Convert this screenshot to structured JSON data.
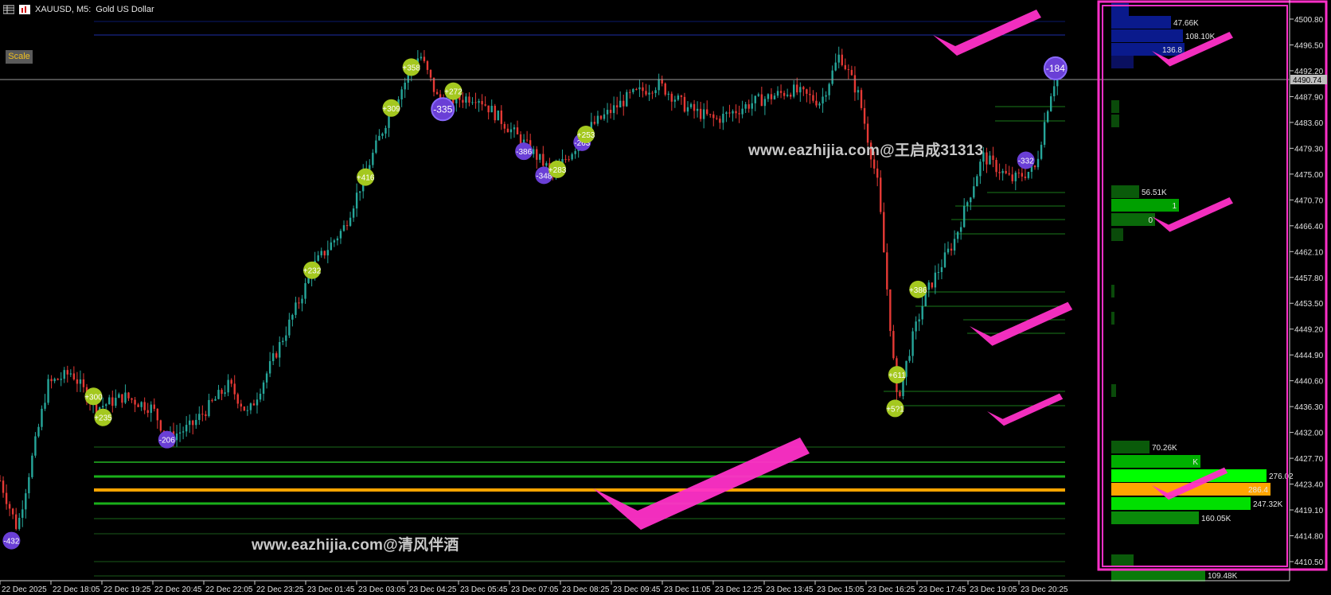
{
  "header": {
    "symbol_label": "XAUUSD, M5:",
    "description": "Gold US Dollar"
  },
  "toolbar": {
    "scale_label": "Scale"
  },
  "watermarks": [
    "www.eazhijia.com@王启成31313",
    "www.eazhijia.com@清风伴酒"
  ],
  "colors": {
    "bull": "#26a69a",
    "bear": "#e53935",
    "buy_badge": "#a4c81f",
    "sell_badge": "#6a3fd6",
    "poc": "#ffa500",
    "vol_dark": "#0a5a0a",
    "vol_mid": "#00a000",
    "vol_bright": "#00ff00",
    "vol_blue": "#0a1a8c",
    "annotation": "#ff30c8"
  },
  "price_axis": {
    "labels": [
      "4500.80",
      "4496.50",
      "4492.20",
      "4487.90",
      "4483.60",
      "4479.30",
      "4475.00",
      "4470.70",
      "4466.40",
      "4462.10",
      "4457.80",
      "4453.50",
      "4449.20",
      "4444.90",
      "4440.60",
      "4436.30",
      "4432.00",
      "4427.70",
      "4423.40",
      "4419.10",
      "4414.80",
      "4410.50"
    ],
    "current_price": "4490.74",
    "max": 4503.0,
    "min": 4408.0
  },
  "time_axis": {
    "labels": [
      "22 Dec 2025",
      "22 Dec 18:05",
      "22 Dec 19:25",
      "22 Dec 20:45",
      "22 Dec 22:05",
      "22 Dec 23:25",
      "23 Dec 01:45",
      "23 Dec 03:05",
      "23 Dec 04:25",
      "23 Dec 05:45",
      "23 Dec 07:05",
      "23 Dec 08:25",
      "23 Dec 09:45",
      "23 Dec 11:05",
      "23 Dec 12:25",
      "23 Dec 13:45",
      "23 Dec 15:05",
      "23 Dec 16:25",
      "23 Dec 17:45",
      "23 Dec 19:05",
      "23 Dec 20:25"
    ]
  },
  "volume_profile": {
    "labels": [
      "47.66K",
      "108.10K",
      "136.8",
      "56.51K",
      "1",
      "0",
      "70.26K",
      "K",
      "276.02",
      "286.4",
      "247.32K",
      "160.05K",
      "109.48K"
    ]
  },
  "badges": [
    {
      "label": "-432",
      "type": "sell",
      "price": 4414.0,
      "t": 0.012
    },
    {
      "label": "+300",
      "type": "buy",
      "price": 4438.0,
      "t": 0.098
    },
    {
      "label": "+235",
      "type": "buy",
      "price": 4434.5,
      "t": 0.108
    },
    {
      "label": "-206",
      "type": "sell",
      "price": 4430.8,
      "t": 0.175
    },
    {
      "label": "+232",
      "type": "buy",
      "price": 4459.0,
      "t": 0.327
    },
    {
      "label": "+416",
      "type": "buy",
      "price": 4474.5,
      "t": 0.383
    },
    {
      "label": "+309",
      "type": "buy",
      "price": 4486.0,
      "t": 0.41
    },
    {
      "label": "+358",
      "type": "buy",
      "price": 4492.8,
      "t": 0.431
    },
    {
      "label": "-335",
      "type": "sell",
      "price": 4485.8,
      "t": 0.464
    },
    {
      "label": "+272",
      "type": "buy",
      "price": 4488.8,
      "t": 0.475
    },
    {
      "label": "-386",
      "type": "sell",
      "price": 4478.8,
      "t": 0.549
    },
    {
      "label": "-348",
      "type": "sell",
      "price": 4474.8,
      "t": 0.57
    },
    {
      "label": "+283",
      "type": "buy",
      "price": 4475.8,
      "t": 0.584
    },
    {
      "label": "-263",
      "type": "sell",
      "price": 4480.3,
      "t": 0.61
    },
    {
      "label": "+253",
      "type": "buy",
      "price": 4481.6,
      "t": 0.614
    },
    {
      "label": "+611",
      "type": "buy",
      "price": 4441.6,
      "t": 0.94
    },
    {
      "label": "+5?1",
      "type": "buy",
      "price": 4436.0,
      "t": 0.938
    },
    {
      "label": "+386",
      "type": "buy",
      "price": 4455.8,
      "t": 0.962
    },
    {
      "label": "-332",
      "type": "sell",
      "price": 4477.3,
      "t": 1.075
    },
    {
      "label": "-184",
      "type": "sell",
      "price": 4492.6,
      "t": 1.106
    }
  ]
}
